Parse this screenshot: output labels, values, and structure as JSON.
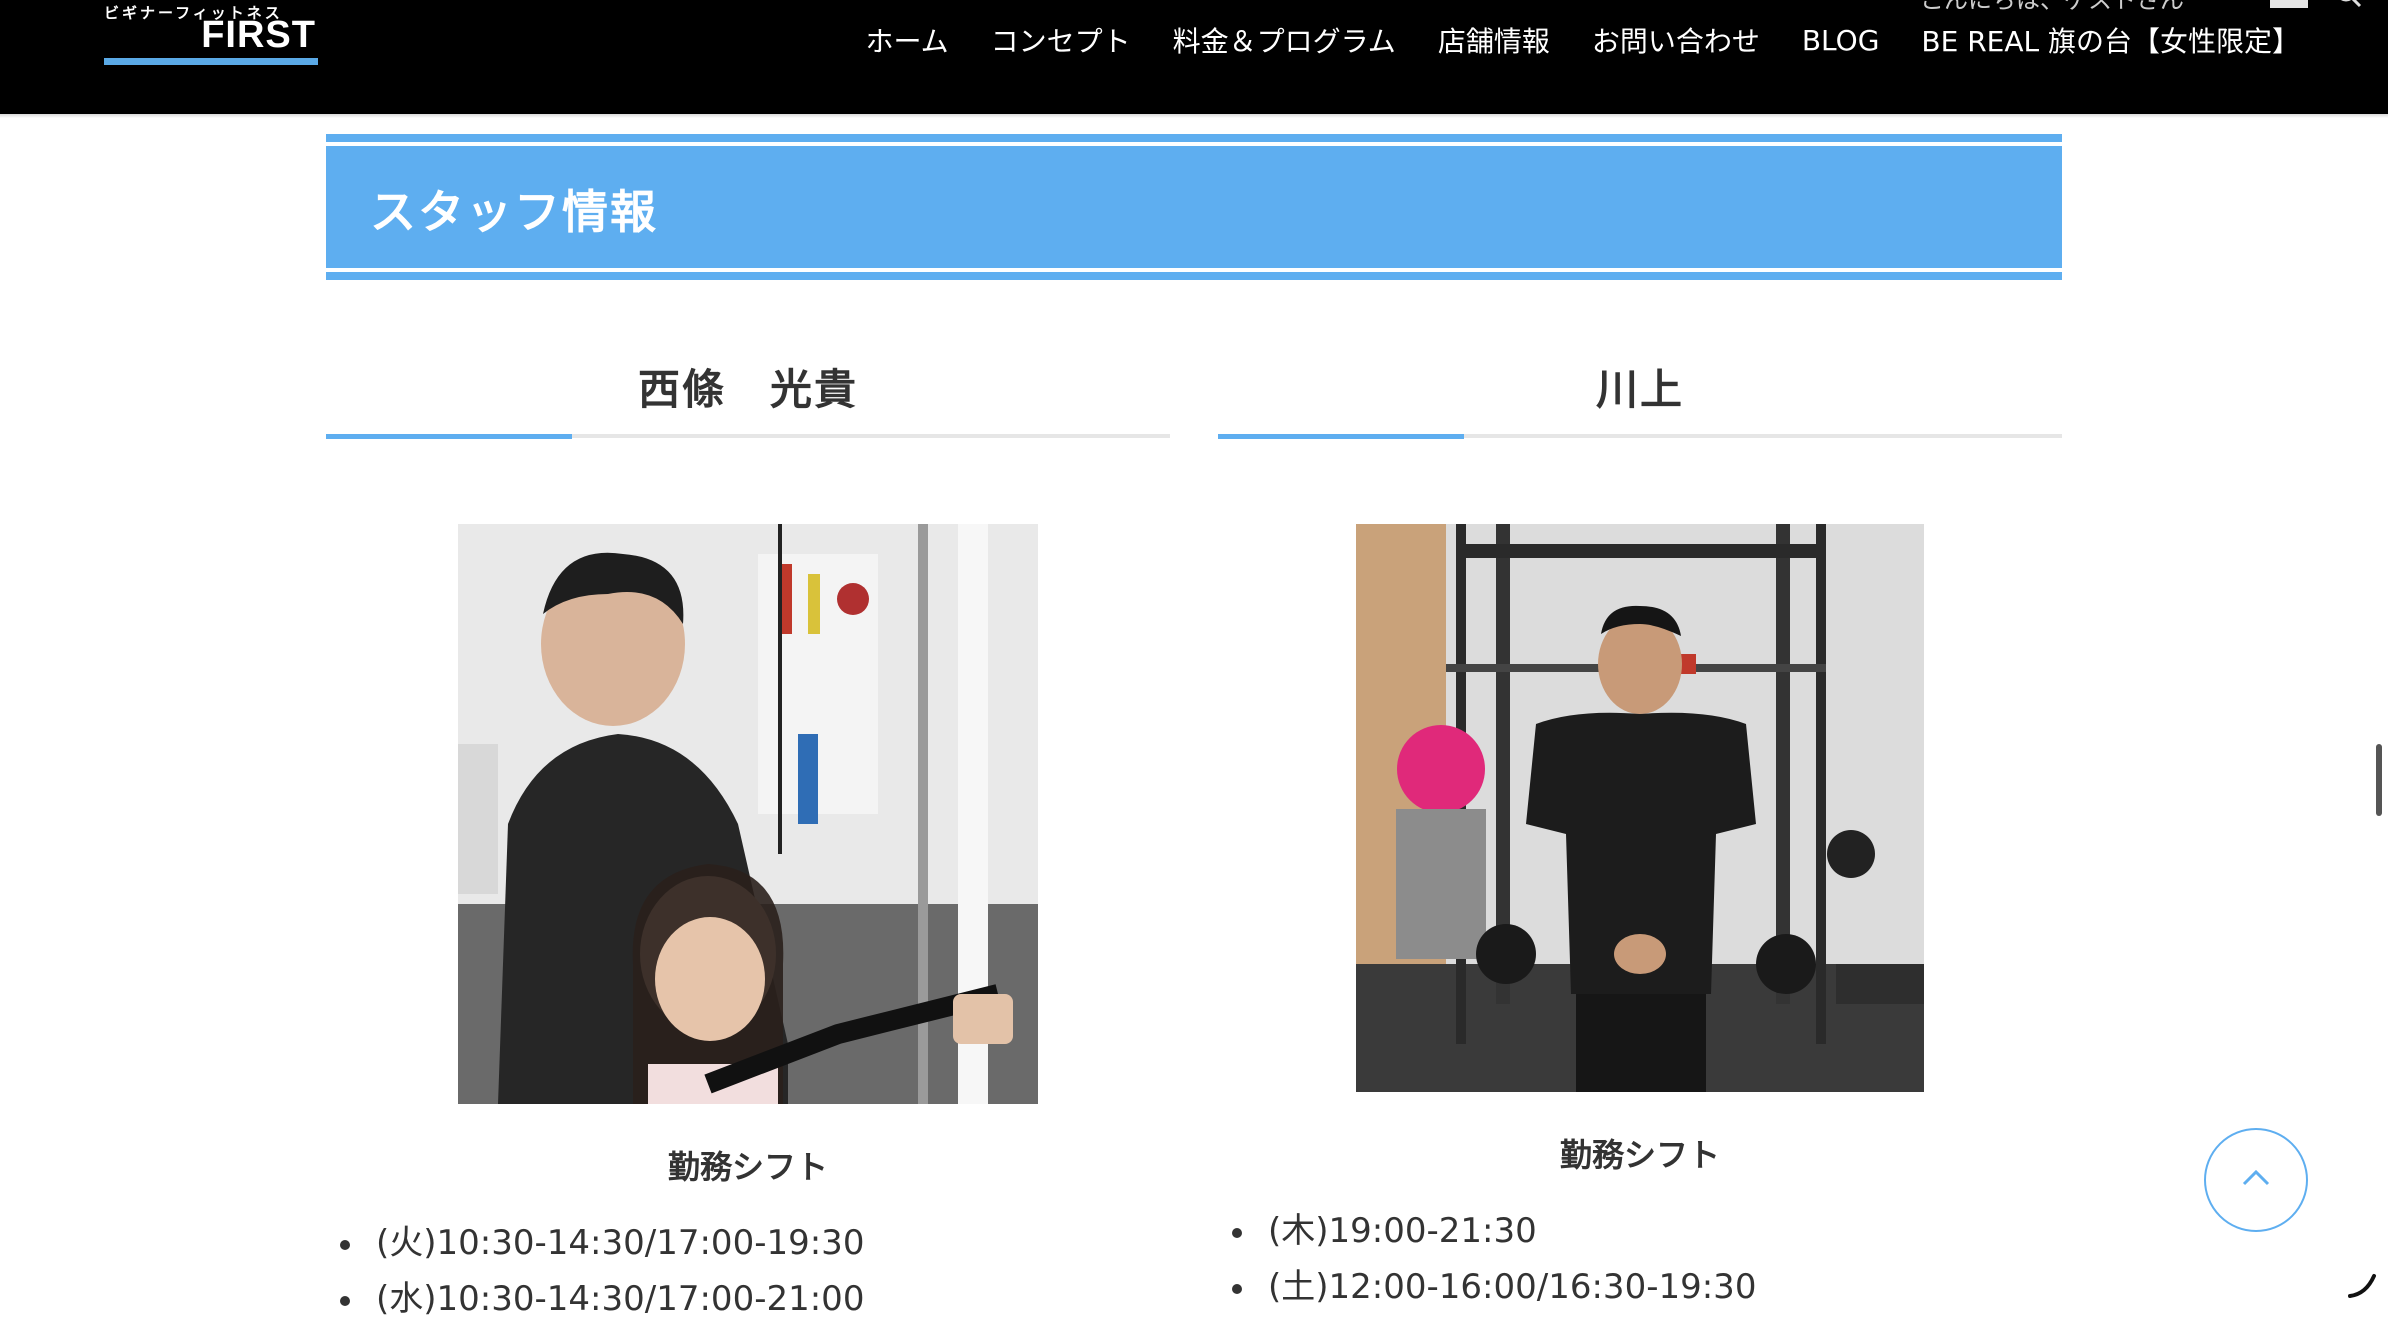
{
  "header": {
    "logo_kana": "ビギナーフィットネス",
    "logo_word": "FIRST",
    "top_line": "こんにちは、ゲストさん",
    "nav": [
      "ホーム",
      "コンセプト",
      "料金＆プログラム",
      "店舗情報",
      "お問い合わせ",
      "BLOG",
      "BE REAL 旗の台【女性限定】"
    ]
  },
  "section": {
    "title": "スタッフ情報"
  },
  "staff": [
    {
      "name": "西條　光貴",
      "shift_title": "勤務シフト",
      "shifts": [
        "(火)10:30-14:30/17:00-19:30",
        "(水)10:30-14:30/17:00-21:00"
      ]
    },
    {
      "name": "川上",
      "shift_title": "勤務シフト",
      "shifts": [
        "(木)19:00-21:30",
        "(土)12:00-16:00/16:30-19:30"
      ]
    }
  ],
  "colors": {
    "accent": "#5eaef0",
    "header_bg": "#000000",
    "text": "#333333"
  },
  "icons": {
    "back_to_top": "chevron-up-icon",
    "search": "search-icon",
    "user": "user-icon"
  }
}
